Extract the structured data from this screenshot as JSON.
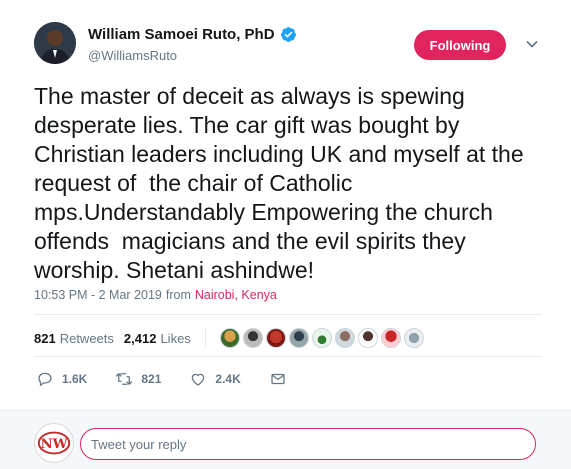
{
  "header": {
    "display_name": "William Samoei Ruto, PhD",
    "handle": "@WilliamsRuto",
    "follow_button": "Following",
    "avatar_icon": "user-avatar-icon",
    "verified_icon": "verified-badge-icon",
    "menu_icon": "chevron-down-icon"
  },
  "tweet": {
    "text": "The master of deceit as always is spewing desperate lies. The car gift was bought by Christian leaders including UK and myself at the request of  the chair of Catholic mps.Understandably Empowering the church offends  magicians and the evil spirits they worship. Shetani ashindwe!",
    "time": "10:53 PM - 2 Mar 2019",
    "from_label": "from",
    "location": "Nairobi, Kenya"
  },
  "stats": {
    "retweets_count": "821",
    "retweets_label": "Retweets",
    "likes_count": "2,412",
    "likes_label": "Likes"
  },
  "actions": {
    "reply_count": "1.6K",
    "retweet_count": "821",
    "like_count": "2.4K"
  },
  "reply": {
    "placeholder": "Tweet your reply",
    "avatar_text": "NW"
  },
  "colors": {
    "accent": "#e0245e",
    "verified": "#1da1f2",
    "muted_text": "#657786"
  }
}
